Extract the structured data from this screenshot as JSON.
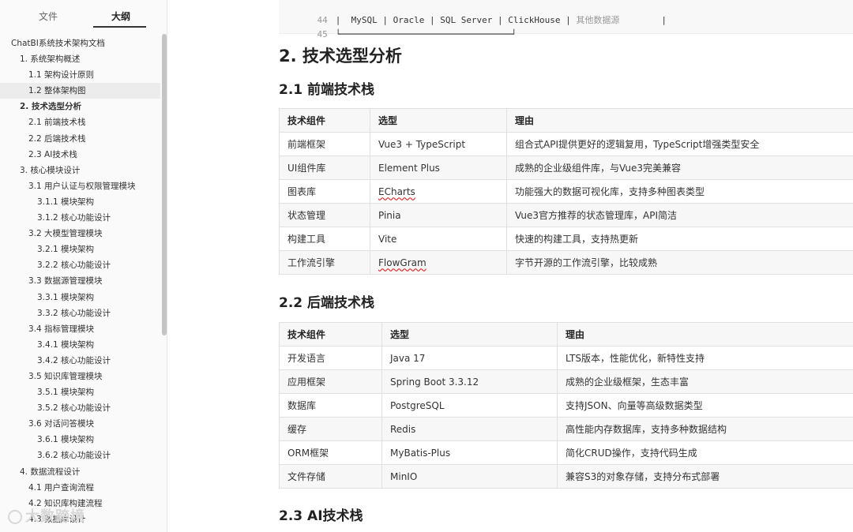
{
  "sidebar": {
    "tabs": {
      "file": "文件",
      "outline": "大纲"
    },
    "toc": [
      {
        "label": "ChatBI系统技术架构文档",
        "level": 0
      },
      {
        "label": "1. 系统架构概述",
        "level": 1
      },
      {
        "label": "1.1 架构设计原则",
        "level": 2
      },
      {
        "label": "1.2 整体架构图",
        "level": 2,
        "active": true
      },
      {
        "label": "2. 技术选型分析",
        "level": 1,
        "bold": true
      },
      {
        "label": "2.1 前端技术栈",
        "level": 2
      },
      {
        "label": "2.2 后端技术栈",
        "level": 2
      },
      {
        "label": "2.3 AI技术栈",
        "level": 2
      },
      {
        "label": "3. 核心模块设计",
        "level": 1
      },
      {
        "label": "3.1 用户认证与权限管理模块",
        "level": 2
      },
      {
        "label": "3.1.1 模块架构",
        "level": 3
      },
      {
        "label": "3.1.2 核心功能设计",
        "level": 3
      },
      {
        "label": "3.2 大模型管理模块",
        "level": 2
      },
      {
        "label": "3.2.1 模块架构",
        "level": 3
      },
      {
        "label": "3.2.2 核心功能设计",
        "level": 3
      },
      {
        "label": "3.3 数据源管理模块",
        "level": 2
      },
      {
        "label": "3.3.1 模块架构",
        "level": 3
      },
      {
        "label": "3.3.2 核心功能设计",
        "level": 3
      },
      {
        "label": "3.4 指标管理模块",
        "level": 2
      },
      {
        "label": "3.4.1 模块架构",
        "level": 3
      },
      {
        "label": "3.4.2 核心功能设计",
        "level": 3
      },
      {
        "label": "3.5 知识库管理模块",
        "level": 2
      },
      {
        "label": "3.5.1 模块架构",
        "level": 3
      },
      {
        "label": "3.5.2 核心功能设计",
        "level": 3
      },
      {
        "label": "3.6 对话问答模块",
        "level": 2
      },
      {
        "label": "3.6.1 模块架构",
        "level": 3
      },
      {
        "label": "3.6.2 核心功能设计",
        "level": 3
      },
      {
        "label": "4. 数据流程设计",
        "level": 1
      },
      {
        "label": "4.1 用户查询流程",
        "level": 2
      },
      {
        "label": "4.2 知识库构建流程",
        "level": 2
      },
      {
        "label": "4.3 数据库设计",
        "level": 2
      }
    ],
    "watermark": "大数跨境"
  },
  "code": {
    "lines": [
      {
        "num": "44",
        "text": "|  MySQL | Oracle | SQL Server | ClickHouse | ",
        "comment": "其他数据源",
        "tail": "        |"
      },
      {
        "num": "45",
        "text": "└──────────────────────────────────────────────────────────────────┘",
        "comment": "",
        "tail": ""
      }
    ]
  },
  "doc": {
    "h1": "2. 技术选型分析",
    "frontend": {
      "heading": "2.1 前端技术栈",
      "headers": [
        "技术组件",
        "选型",
        "理由"
      ],
      "rows": [
        [
          "前端框架",
          "Vue3 + TypeScript",
          "组合式API提供更好的逻辑复用，TypeScript增强类型安全"
        ],
        [
          "UI组件库",
          "Element Plus",
          "成熟的企业级组件库，与Vue3完美兼容"
        ],
        [
          "图表库",
          "ECharts",
          "功能强大的数据可视化库，支持多种图表类型"
        ],
        [
          "状态管理",
          "Pinia",
          "Vue3官方推荐的状态管理库，API简洁"
        ],
        [
          "构建工具",
          "Vite",
          "快速的构建工具，支持热更新"
        ],
        [
          "工作流引擎",
          "FlowGram",
          "字节开源的工作流引擎，比较成熟"
        ]
      ]
    },
    "backend": {
      "heading": "2.2 后端技术栈",
      "headers": [
        "技术组件",
        "选型",
        "理由"
      ],
      "rows": [
        [
          "开发语言",
          "Java 17",
          "LTS版本，性能优化，新特性支持"
        ],
        [
          "应用框架",
          "Spring Boot 3.3.12",
          "成熟的企业级框架，生态丰富"
        ],
        [
          "数据库",
          "PostgreSQL",
          "支持JSON、向量等高级数据类型"
        ],
        [
          "缓存",
          "Redis",
          "高性能内存数据库，支持多种数据结构"
        ],
        [
          "ORM框架",
          "MyBatis-Plus",
          "简化CRUD操作，支持代码生成"
        ],
        [
          "文件存储",
          "MinIO",
          "兼容S3的对象存储，支持分布式部署"
        ]
      ]
    },
    "ai": {
      "heading": "2.3 AI技术栈"
    }
  }
}
